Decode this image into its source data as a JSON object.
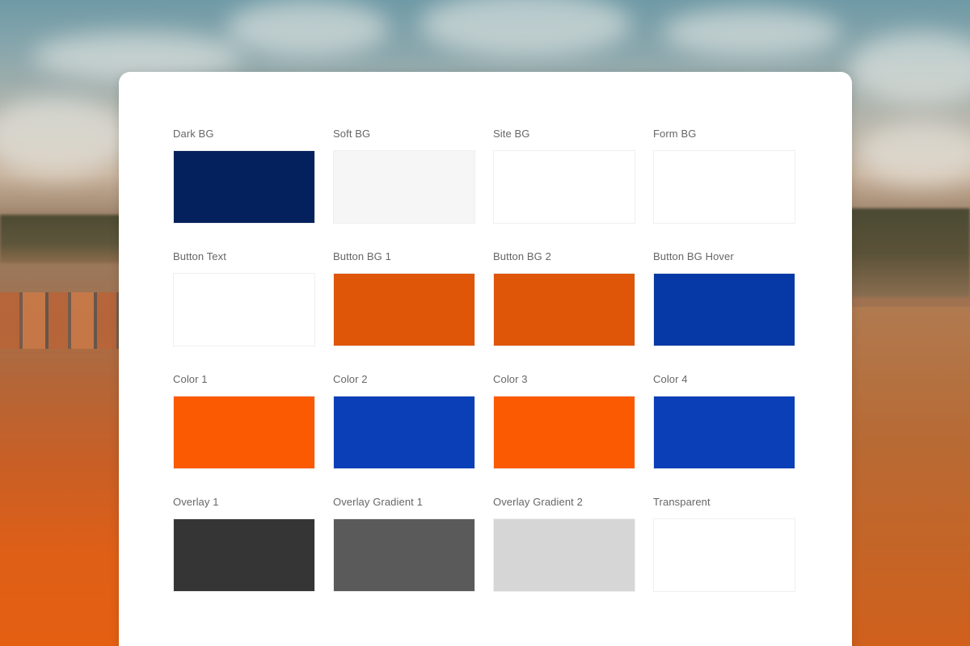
{
  "swatches": [
    {
      "label": "Dark BG",
      "color": "#05215d"
    },
    {
      "label": "Soft BG",
      "color": "#f6f6f6"
    },
    {
      "label": "Site BG",
      "color": "#ffffff"
    },
    {
      "label": "Form BG",
      "color": "#ffffff"
    },
    {
      "label": "Button Text",
      "color": "#ffffff"
    },
    {
      "label": "Button BG 1",
      "color": "#e05608"
    },
    {
      "label": "Button BG 2",
      "color": "#e05608"
    },
    {
      "label": "Button BG Hover",
      "color": "#0639a6"
    },
    {
      "label": "Color 1",
      "color": "#fb5a03"
    },
    {
      "label": "Color 2",
      "color": "#0a3fb8"
    },
    {
      "label": "Color 3",
      "color": "#fb5a03"
    },
    {
      "label": "Color 4",
      "color": "#0a3fb8"
    },
    {
      "label": "Overlay 1",
      "color": "#353535"
    },
    {
      "label": "Overlay Gradient 1",
      "color": "#5a5a5a"
    },
    {
      "label": "Overlay Gradient 2",
      "color": "#d6d6d6"
    },
    {
      "label": "Transparent",
      "color": "#ffffff"
    }
  ]
}
